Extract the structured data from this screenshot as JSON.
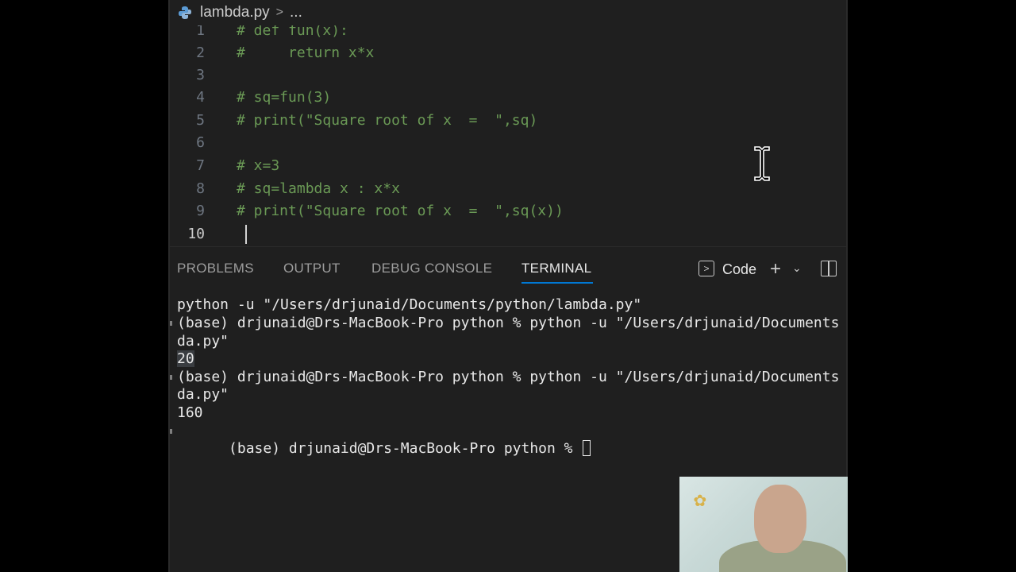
{
  "editor": {
    "breadcrumb": {
      "file": "lambda.py",
      "separator": ">",
      "more": "..."
    },
    "active_line": 10,
    "lines": [
      {
        "n": "1",
        "text": "# def fun(x):"
      },
      {
        "n": "2",
        "text": "#     return x*x"
      },
      {
        "n": "3",
        "text": ""
      },
      {
        "n": "4",
        "text": "# sq=fun(3)"
      },
      {
        "n": "5",
        "text": "# print(\"Square root of x  =  \",sq)"
      },
      {
        "n": "6",
        "text": ""
      },
      {
        "n": "7",
        "text": "# x=3"
      },
      {
        "n": "8",
        "text": "# sq=lambda x : x*x"
      },
      {
        "n": "9",
        "text": "# print(\"Square root of x  =  \",sq(x))"
      },
      {
        "n": "10",
        "text": ""
      }
    ],
    "comment_color": "#6a9955"
  },
  "panel": {
    "tabs": [
      {
        "label": "PROBLEMS"
      },
      {
        "label": "OUTPUT"
      },
      {
        "label": "DEBUG CONSOLE"
      },
      {
        "label": "TERMINAL",
        "active": true
      }
    ],
    "terminal_profile": "Code",
    "icons": [
      "terminal-icon",
      "plus-icon",
      "chevron-down-icon",
      "split-panel-icon"
    ]
  },
  "terminal": {
    "lines": [
      "python -u \"/Users/drjunaid/Documents/python/lambda.py\"",
      "(base) drjunaid@Drs-MacBook-Pro python % python -u \"/Users/drjunaid/Documents",
      "da.py\"",
      "20",
      "(base) drjunaid@Drs-MacBook-Pro python % python -u \"/Users/drjunaid/Documents",
      "da.py\"",
      "160",
      "(base) drjunaid@Drs-MacBook-Pro python % "
    ],
    "selected_line_index": 3
  },
  "colors": {
    "accent": "#0078d4",
    "background": "#1f1f1f"
  }
}
